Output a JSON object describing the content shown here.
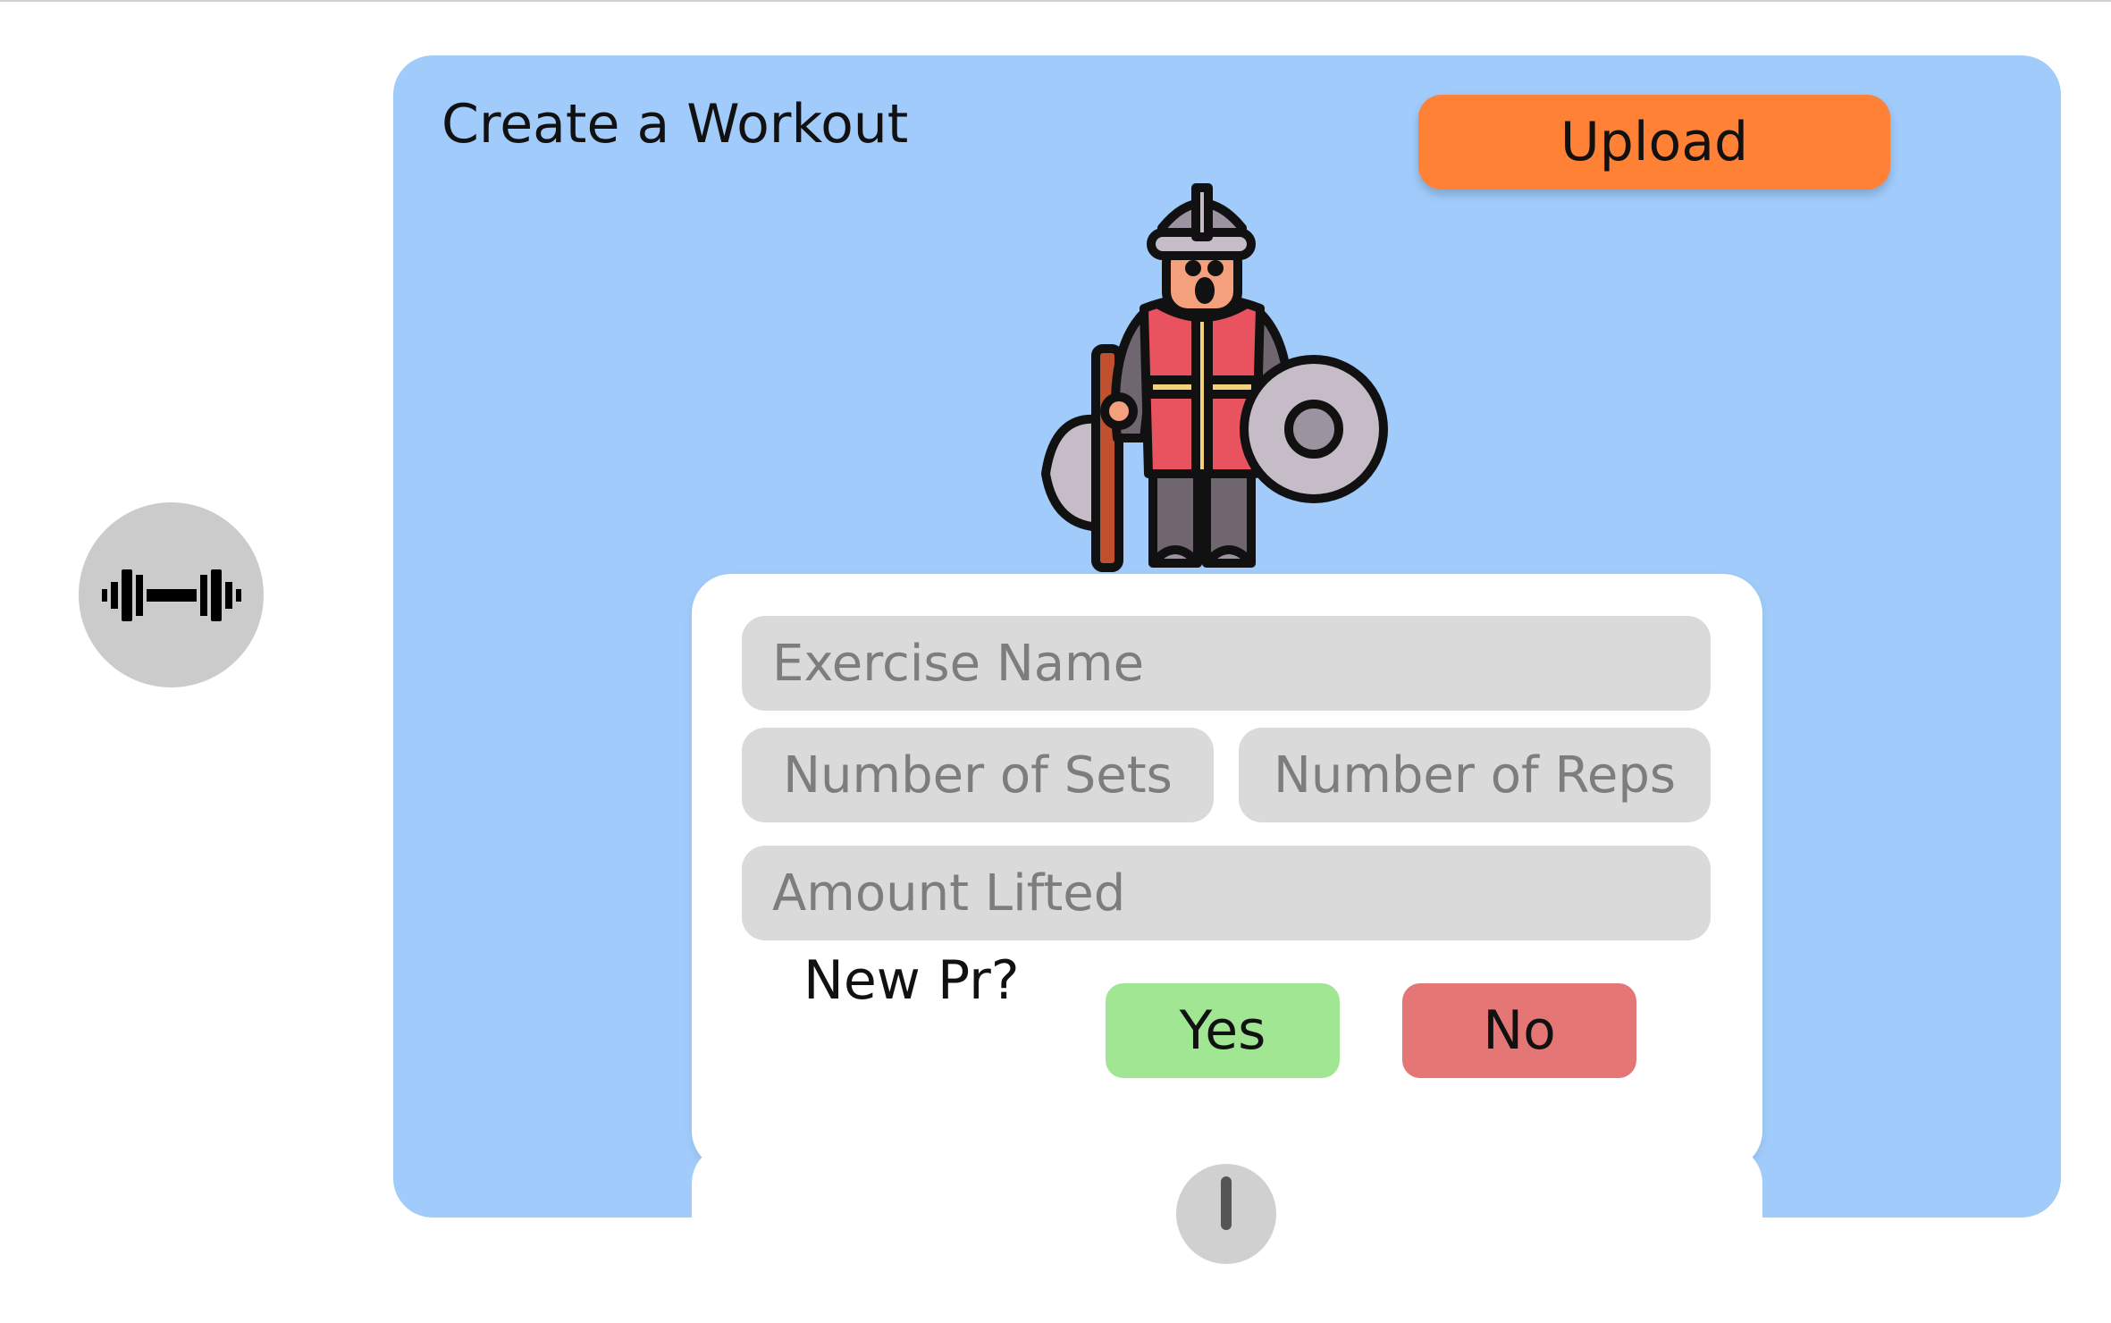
{
  "sidebar": {
    "workout_icon": "dumbbell-icon"
  },
  "panel": {
    "title": "Create a Workout",
    "upload_label": "Upload",
    "mascot": "viking-warrior-illustration"
  },
  "form": {
    "exercise_placeholder": "Exercise Name",
    "sets_placeholder": "Number of Sets",
    "reps_placeholder": "Number of Reps",
    "amount_placeholder": "Amount Lifted",
    "pr_label": "New Pr?",
    "yes_label": "Yes",
    "no_label": "No"
  },
  "add_card": {
    "icon": "plus-icon"
  },
  "colors": {
    "panel_bg": "#a0cbfb",
    "upload": "#fe8136",
    "yes": "#a1e693",
    "no": "#e57676",
    "field_bg": "#dadada",
    "side_button": "#cbcbcb"
  }
}
